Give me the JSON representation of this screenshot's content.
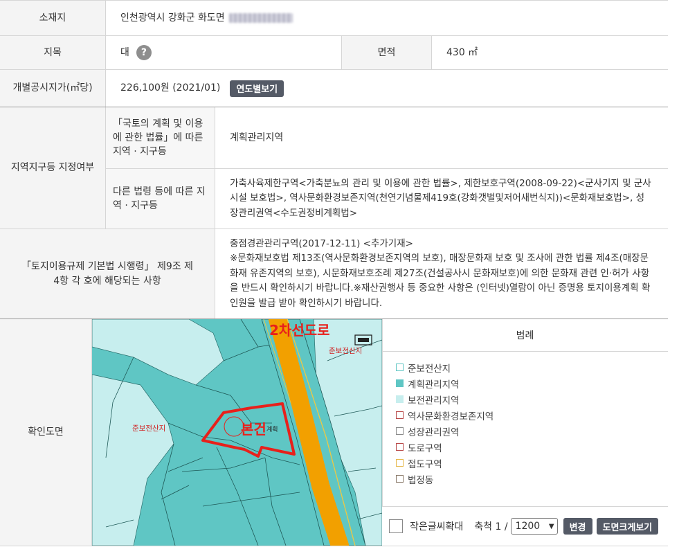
{
  "location": {
    "label": "소재지",
    "value": "인천광역시 강화군 화도면"
  },
  "land": {
    "label": "지목",
    "value": "대",
    "help": "?",
    "area_label": "면적",
    "area_value": "430 ㎡"
  },
  "price": {
    "label": "개별공시지가(㎡당)",
    "value": "226,100원 (2021/01)",
    "button": "연도별보기"
  },
  "zone": {
    "label": "지역지구등 지정여부",
    "sub1_label": "「국토의 계획 및 이용에 관한 법률」에 따른 지역 · 지구등",
    "sub1_value": "계획관리지역",
    "sub2_label": "다른 법령 등에 따른 지역 · 지구등",
    "sub2_value": "가축사육제한구역<가축분뇨의 관리 및 이용에 관한 법률>, 제한보호구역(2008-09-22)<군사기지 및 군사시설 보호법>, 역사문화환경보존지역(천연기념물제419호(강화갯벌및저어새번식지))<문화재보호법>, 성장관리권역<수도권정비계획법>"
  },
  "regulation": {
    "label": "「토지이용규제 기본법 시행령」 제9조 제4항 각 호에 해당되는 사항",
    "line1": "중점경관관리구역(2017-12-11) <추가기재>",
    "line2": "※문화재보호법 제13조(역사문화환경보존지역의 보호), 매장문화재 보호 및 조사에 관한 법률 제4조(매장문화재 유존지역의 보호), 시문화재보호조례 제27조(건설공사시 문화재보호)에 의한 문화재 관련 인·허가 사항을 반드시 확인하시기 바랍니다.※재산권행사 등 중요한 사항은 (인터넷)열람이 아닌 증명용 토지이용계획 확인원을 발급 받아 확인하시기 바랍니다."
  },
  "map_section": {
    "label": "확인도면",
    "annotations": {
      "road": "2차선도로",
      "parcel": "본건",
      "forest_left": "준보전산지",
      "forest_right": "준보전산지",
      "lot_label": "계획"
    },
    "legend_title": "범례",
    "legend": [
      {
        "label": "준보전산지",
        "color": "#5fc6c4",
        "fill": "#ffffff"
      },
      {
        "label": "계획관리지역",
        "color": "#5fc6c4",
        "fill": "#5fc6c4"
      },
      {
        "label": "보전관리지역",
        "color": "#c7eeee",
        "fill": "#c7eeee"
      },
      {
        "label": "역사문화환경보존지역",
        "color": "#b94a4a",
        "fill": "#ffffff"
      },
      {
        "label": "성장관리권역",
        "color": "#8a8a8a",
        "fill": "#ffffff"
      },
      {
        "label": "도로구역",
        "color": "#b94a4a",
        "fill": "#ffffff"
      },
      {
        "label": "접도구역",
        "color": "#e6b84a",
        "fill": "#ffffff"
      },
      {
        "label": "법정동",
        "color": "#8a7a6a",
        "fill": "#ffffff"
      }
    ],
    "small_text_label": "작은글씨확대",
    "scale_label": "축척 1 /",
    "scale_value": "1200",
    "change_button": "변경",
    "enlarge_button": "도면크게보기"
  },
  "colors": {
    "header_bg": "#f4f4f4",
    "button_bg": "#545a66",
    "map_teal": "#5fc6c4",
    "map_light": "#c7eeee",
    "road_orange": "#f2a000",
    "annot_red": "#e8201b"
  }
}
